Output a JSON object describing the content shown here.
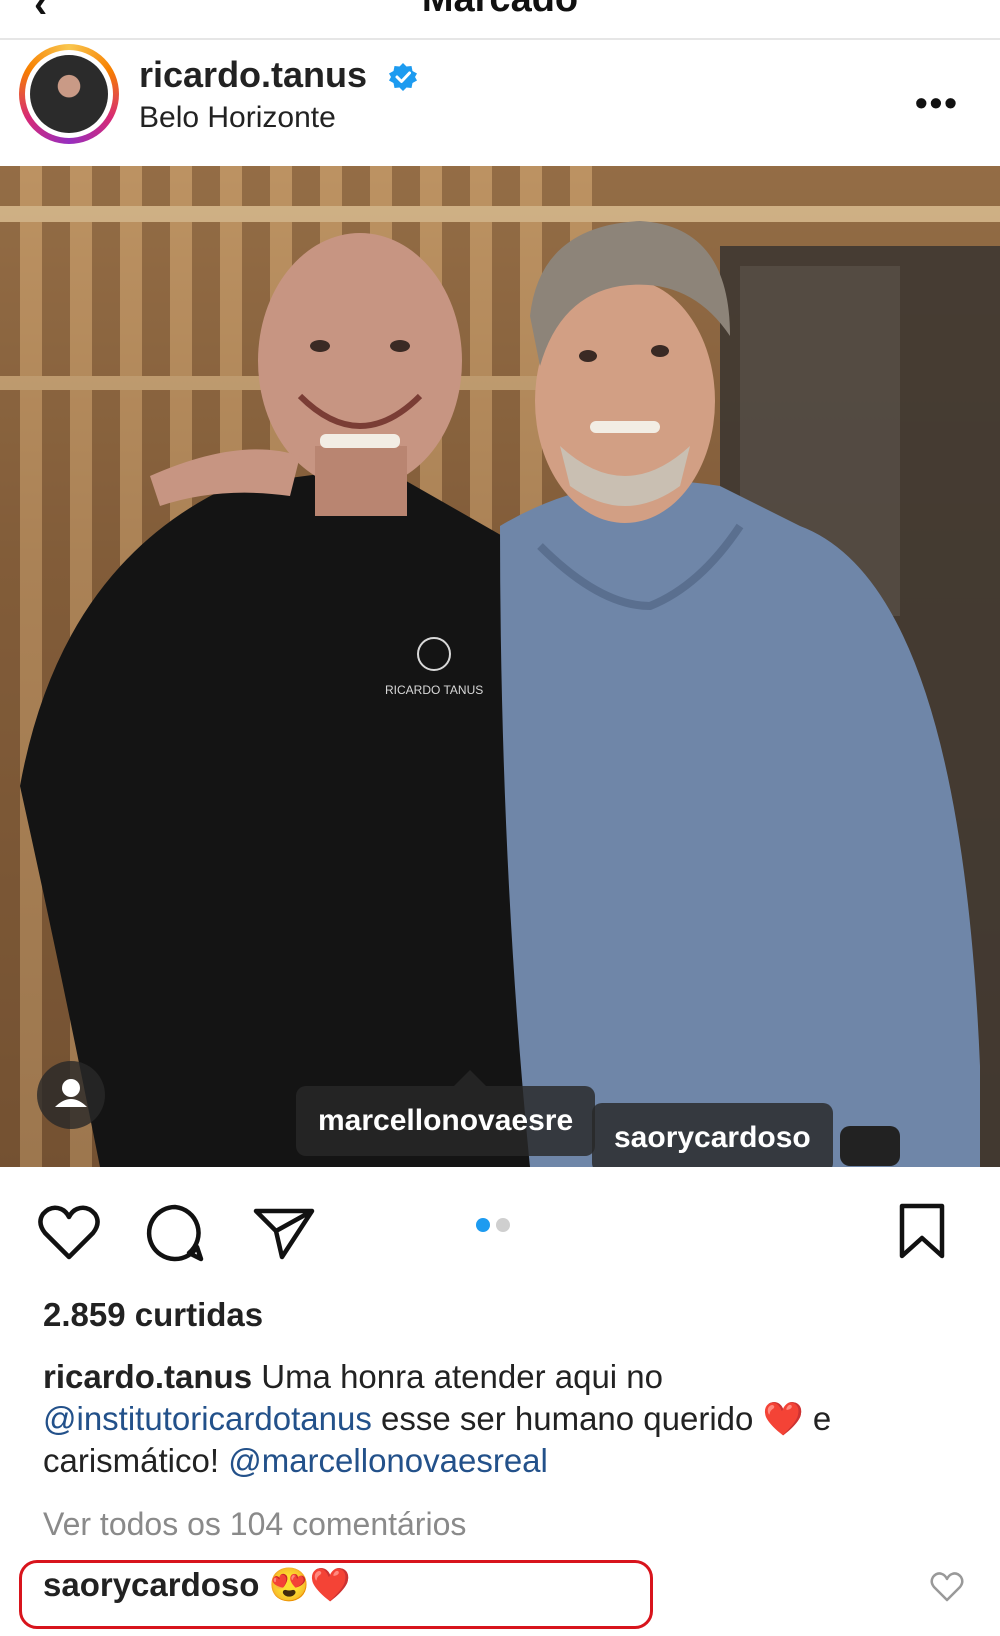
{
  "topbar": {
    "title": "Marcado",
    "back_icon": "‹"
  },
  "post": {
    "username": "ricardo.tanus",
    "location": "Belo Horizonte",
    "more_icon": "•••",
    "photo_tags": [
      "marcellonovaesre",
      "saorycardoso"
    ],
    "shirt_logo_text": "RICARDO TANUS",
    "carousel": {
      "current": 1,
      "total": 2
    },
    "likes": "2.859 curtidas",
    "caption": {
      "username": "ricardo.tanus",
      "text_1": " Uma honra atender aqui no ",
      "mention_1": "@institutoricardotanus",
      "text_2": " esse ser humano querido ❤️ e carismático! ",
      "mention_2": "@marcellonovaesreal"
    },
    "view_comments": "Ver todos os 104 comentários",
    "comment": {
      "username": "saorycardoso",
      "emoji": "😍❤️"
    }
  },
  "colors": {
    "accent": "#1d9bf0",
    "highlight": "#d8141c",
    "mention": "#23518a"
  }
}
